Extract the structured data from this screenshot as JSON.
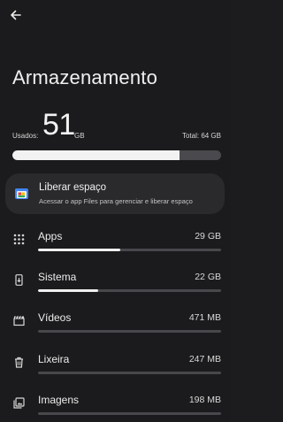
{
  "header": {
    "back_icon": "arrow-back-icon"
  },
  "page": {
    "title": "Armazenamento"
  },
  "usage": {
    "used_label": "Usados:",
    "used_value": "51",
    "used_unit": "GB",
    "total_label": "Total: 64 GB",
    "used_fraction": 0.8
  },
  "free_space": {
    "title": "Liberar espaço",
    "subtitle": "Acessar o app Files para gerenciar e liberar espaço",
    "icon": "files-app-icon"
  },
  "categories": [
    {
      "label": "Apps",
      "size": "29 GB",
      "icon": "apps-grid-icon",
      "fraction": 0.45
    },
    {
      "label": "Sistema",
      "size": "22 GB",
      "icon": "system-phone-icon",
      "fraction": 0.33
    },
    {
      "label": "Vídeos",
      "size": "471 MB",
      "icon": "video-clapper-icon",
      "fraction": 0.0
    },
    {
      "label": "Lixeira",
      "size": "247 MB",
      "icon": "trash-icon",
      "fraction": 0.0
    },
    {
      "label": "Imagens",
      "size": "198 MB",
      "icon": "image-icon",
      "fraction": 0.0
    }
  ]
}
